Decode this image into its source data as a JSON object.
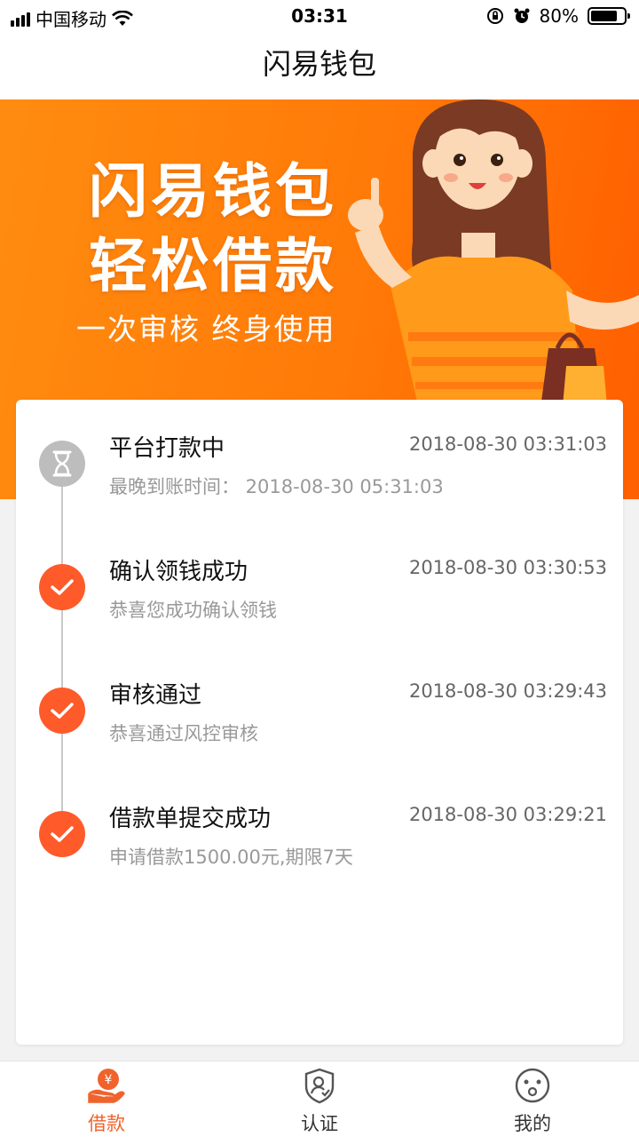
{
  "status_bar": {
    "carrier": "中国移动",
    "time": "03:31",
    "battery": "80%",
    "battery_level": 0.8
  },
  "nav": {
    "title": "闪易钱包"
  },
  "banner": {
    "headline_line1": "闪易钱包",
    "headline_line2": "轻松借款",
    "tagline": "一次审核 终身使用"
  },
  "timeline": [
    {
      "title": "平台打款中",
      "time": "2018-08-30 03:31:03",
      "desc": "最晚到账时间：  2018-08-30 05:31:03",
      "state": "pending"
    },
    {
      "title": "确认领钱成功",
      "time": "2018-08-30 03:30:53",
      "desc": "恭喜您成功确认领钱",
      "state": "done"
    },
    {
      "title": "审核通过",
      "time": "2018-08-30 03:29:43",
      "desc": "恭喜通过风控审核",
      "state": "done"
    },
    {
      "title": "借款单提交成功",
      "time": "2018-08-30 03:29:21",
      "desc": "申请借款1500.00元,期限7天",
      "state": "done"
    }
  ],
  "tabs": [
    {
      "label": "借款",
      "icon": "loan-hand-icon",
      "active": true
    },
    {
      "label": "认证",
      "icon": "shield-user-icon",
      "active": false
    },
    {
      "label": "我的",
      "icon": "face-icon",
      "active": false
    }
  ],
  "colors": {
    "accent": "#ff5a2a",
    "banner": "#ff7a08",
    "pending": "#bdbdbd",
    "tab_active": "#f0632d",
    "tab_inactive": "#333333"
  }
}
